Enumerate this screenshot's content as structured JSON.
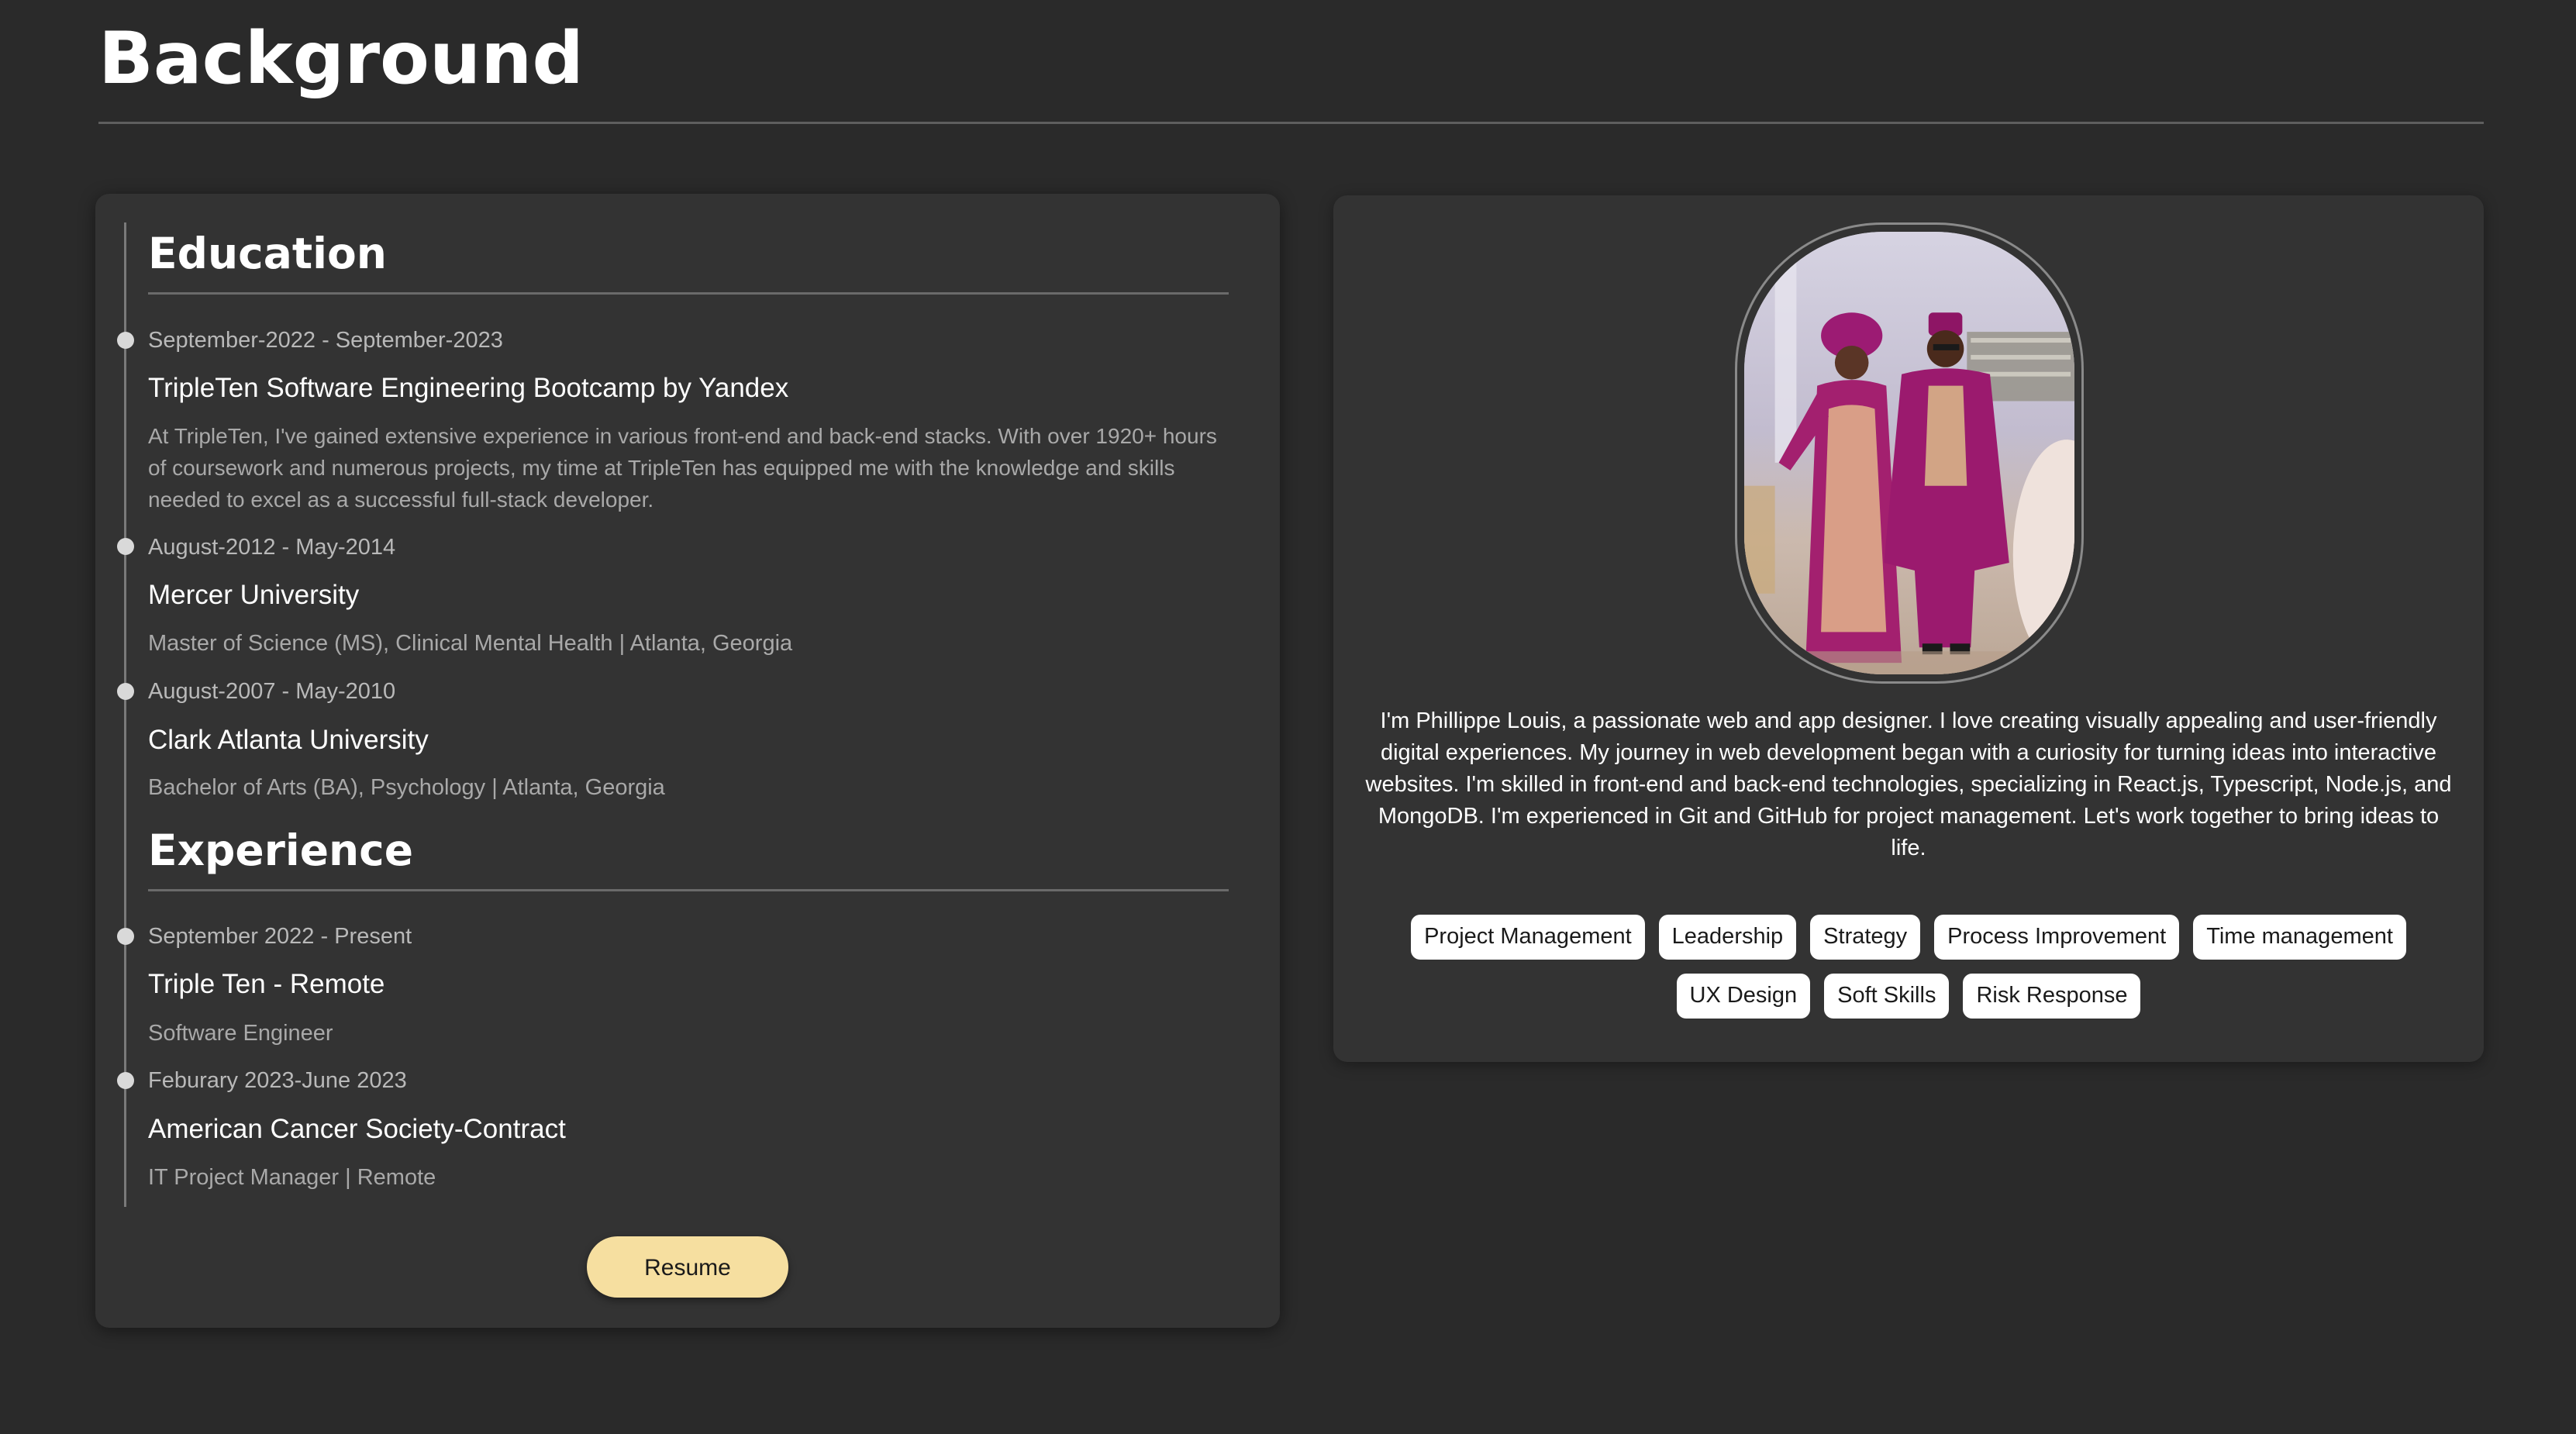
{
  "page": {
    "title": "Background"
  },
  "education": {
    "heading": "Education",
    "entries": [
      {
        "date": "September-2022 - September-2023",
        "title": "TripleTen Software Engineering Bootcamp by Yandex",
        "description": "At TripleTen, I've gained extensive experience in various front-end and back-end stacks. With over 1920+ hours of coursework and numerous projects, my time at TripleTen has equipped me with the knowledge and skills needed to excel as a successful full-stack developer."
      },
      {
        "date": "August-2012 - May-2014",
        "title": "Mercer University",
        "description": "Master of Science (MS), Clinical Mental Health | Atlanta, Georgia"
      },
      {
        "date": "August-2007 - May-2010",
        "title": "Clark Atlanta University",
        "description": "Bachelor of Arts (BA), Psychology | Atlanta, Georgia"
      }
    ]
  },
  "experience": {
    "heading": "Experience",
    "entries": [
      {
        "date": "September 2022 - Present",
        "title": "Triple Ten - Remote",
        "description": "Software Engineer"
      },
      {
        "date": "Feburary 2023-June 2023",
        "title": "American Cancer Society-Contract",
        "description": "IT Project Manager | Remote"
      }
    ]
  },
  "resume_button": {
    "label": "Resume"
  },
  "about": {
    "photo_icon": "profile-photo",
    "bio": "I'm Phillippe Louis, a passionate web and app designer. I love creating visually appealing and user-friendly digital experiences. My journey in web development began with a curiosity for turning ideas into interactive websites. I'm skilled in front-end and back-end technologies, specializing in React.js, Typescript, Node.js, and MongoDB. I'm experienced in Git and GitHub for project management. Let's work together to bring ideas to life.",
    "skills": [
      "Project Management",
      "Leadership",
      "Strategy",
      "Process Improvement",
      "Time management",
      "UX Design",
      "Soft Skills",
      "Risk Response"
    ]
  },
  "colors": {
    "background": "#2a2a2a",
    "card": "#333333",
    "accent_button": "#f6dfa0",
    "tag_background": "#ffffff"
  }
}
